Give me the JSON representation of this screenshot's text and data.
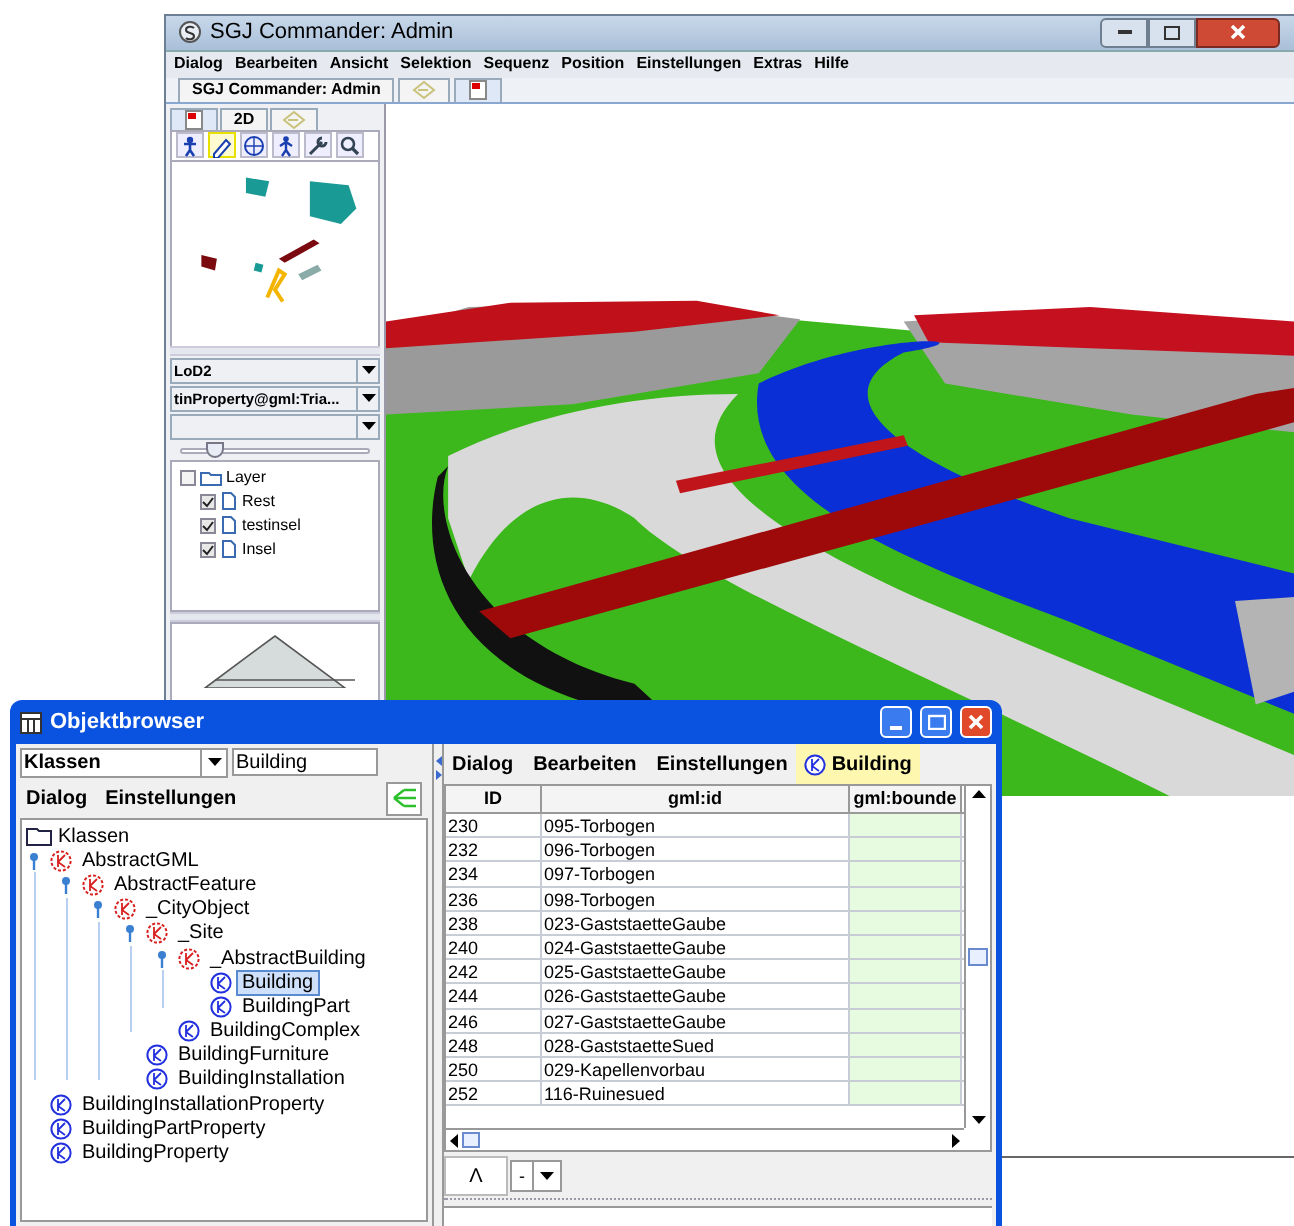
{
  "main_window": {
    "title": "SGJ Commander: Admin",
    "menu": [
      "Dialog",
      "Bearbeiten",
      "Ansicht",
      "Selektion",
      "Sequenz",
      "Position",
      "Einstellungen",
      "Extras",
      "Hilfe"
    ],
    "tabs": [
      {
        "kind": "text",
        "label": "SGJ Commander: Admin",
        "selected": false
      },
      {
        "kind": "icon",
        "selected": false
      },
      {
        "kind": "icon",
        "selected": true
      }
    ],
    "side_panel": {
      "tabs": [
        {
          "kind": "icon",
          "selected": true
        },
        {
          "kind": "text",
          "label": "2D",
          "selected": false
        },
        {
          "kind": "icon",
          "selected": false
        }
      ],
      "tools": [
        {
          "selected": false
        },
        {
          "selected": true
        },
        {
          "selected": false
        },
        {
          "selected": false
        },
        {
          "selected": false
        },
        {
          "selected": false
        }
      ],
      "combos": [
        {
          "kind": "text",
          "value": "LoD2"
        },
        {
          "kind": "text",
          "value": "tinProperty@gml:Tria..."
        },
        {
          "kind": "blank"
        }
      ],
      "slider": {
        "level": 0.18
      },
      "layers": {
        "label": "Layer",
        "checked": false,
        "children": [
          {
            "label": "Rest",
            "checked": true
          },
          {
            "label": "testinsel",
            "checked": true
          },
          {
            "label": "Insel",
            "checked": true
          }
        ]
      }
    }
  },
  "objektbrowser": {
    "title": "Objektbrowser",
    "filter": {
      "combo": "Klassen",
      "field": "Building"
    },
    "tree_menu": [
      "Dialog",
      "Einstellungen"
    ],
    "tree": {
      "label": "Klassen",
      "children": [
        {
          "label": "AbstractGML",
          "abstract": true,
          "selected": false,
          "expanded": true,
          "children": [
            {
              "label": "AbstractFeature",
              "abstract": true,
              "selected": false,
              "expanded": true,
              "children": [
                {
                  "label": "_CityObject",
                  "abstract": true,
                  "selected": false,
                  "expanded": true,
                  "children": [
                    {
                      "label": "_Site",
                      "abstract": true,
                      "selected": false,
                      "expanded": true,
                      "children": [
                        {
                          "label": "_AbstractBuilding",
                          "abstract": true,
                          "selected": false,
                          "expanded": true,
                          "children": [
                            {
                              "label": "Building",
                              "abstract": false,
                              "selected": true
                            },
                            {
                              "label": "BuildingPart",
                              "abstract": false,
                              "selected": false
                            }
                          ]
                        },
                        {
                          "label": "BuildingComplex",
                          "abstract": false,
                          "selected": false
                        }
                      ]
                    },
                    {
                      "label": "BuildingFurniture",
                      "abstract": false,
                      "selected": false
                    },
                    {
                      "label": "BuildingInstallation",
                      "abstract": false,
                      "selected": false
                    }
                  ]
                }
              ]
            }
          ]
        },
        {
          "label": "BuildingInstallationProperty",
          "abstract": false,
          "selected": false
        },
        {
          "label": "BuildingPartProperty",
          "abstract": false,
          "selected": false
        },
        {
          "label": "BuildingProperty",
          "abstract": false,
          "selected": false
        }
      ]
    },
    "table_menu": [
      "Dialog",
      "Bearbeiten",
      "Einstellungen"
    ],
    "active_class": "Building",
    "table": {
      "columns": [
        "ID",
        "gml:id",
        "gml:bounde"
      ],
      "rows": [
        [
          "230",
          "095-Torbogen"
        ],
        [
          "232",
          "096-Torbogen"
        ],
        [
          "234",
          "097-Torbogen"
        ],
        [
          "236",
          "098-Torbogen"
        ],
        [
          "238",
          "023-GaststaetteGaube"
        ],
        [
          "240",
          "024-GaststaetteGaube"
        ],
        [
          "242",
          "025-GaststaetteGaube"
        ],
        [
          "244",
          "026-GaststaetteGaube"
        ],
        [
          "246",
          "027-GaststaetteGaube"
        ],
        [
          "248",
          "028-GaststaetteSued"
        ],
        [
          "250",
          "029-Kapellenvorbau"
        ],
        [
          "252",
          "116-Ruinesued"
        ]
      ]
    },
    "bottom": {
      "button": "Λ",
      "combo": "-"
    }
  }
}
